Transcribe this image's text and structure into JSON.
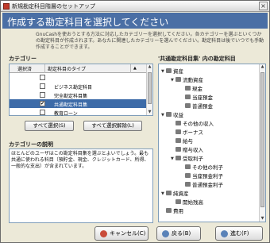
{
  "window": {
    "title": "新規勘定科目階層のセットアップ"
  },
  "banner": {
    "title": "作成する勘定科目を選択してください"
  },
  "intro": "GnuCashを使おうとする方法に対応したカテゴリーを選択してください。各カテゴリーを選ぶといくつかの勘定科目が作成されます。あなたに関連したカテゴリーを選んでください。勘定科目は後でいつでも手動作成することができます。",
  "categories": {
    "label": "カテゴリー",
    "col_selected": "選択済",
    "col_type": "勘定科目のタイプ",
    "rows": [
      {
        "checked": false,
        "name": ""
      },
      {
        "checked": false,
        "name": "ビジネス勘定科目"
      },
      {
        "checked": false,
        "name": "完全勘定科目集"
      },
      {
        "checked": true,
        "name": "共通勘定科目集",
        "selected": true
      },
      {
        "checked": false,
        "name": "教育ローン"
      }
    ],
    "select_all": "すべて選択(S)",
    "clear_all": "すべて選択解除(L)"
  },
  "description": {
    "label": "カテゴリーの説明",
    "text": "ほとんどのユーザはこの勘定科目集を選ぶとよいでしょう。最も共通に使われる科目（預貯金、現金、クレジットカード、所得、一般的な支出）が含まれています。"
  },
  "accounts_tree": {
    "label": "'共通勘定科目集' 内の勘定科目",
    "items": [
      {
        "depth": 0,
        "expanded": true,
        "name": "資産"
      },
      {
        "depth": 1,
        "expanded": true,
        "name": "流動資産"
      },
      {
        "depth": 2,
        "expanded": false,
        "name": "現金"
      },
      {
        "depth": 2,
        "expanded": false,
        "name": "当座預金"
      },
      {
        "depth": 2,
        "expanded": false,
        "name": "普通預金"
      },
      {
        "depth": 0,
        "expanded": true,
        "name": "収益"
      },
      {
        "depth": 1,
        "expanded": false,
        "name": "その他の収入"
      },
      {
        "depth": 1,
        "expanded": false,
        "name": "ボーナス"
      },
      {
        "depth": 1,
        "expanded": false,
        "name": "給与"
      },
      {
        "depth": 1,
        "expanded": false,
        "name": "贈与収入"
      },
      {
        "depth": 1,
        "expanded": true,
        "name": "受取利子"
      },
      {
        "depth": 2,
        "expanded": false,
        "name": "その他の利子"
      },
      {
        "depth": 2,
        "expanded": false,
        "name": "当座預金利子"
      },
      {
        "depth": 2,
        "expanded": false,
        "name": "普通預金利子"
      },
      {
        "depth": 0,
        "expanded": true,
        "name": "純資産"
      },
      {
        "depth": 1,
        "expanded": false,
        "name": "開始残高"
      },
      {
        "depth": 0,
        "expanded": false,
        "name": "費用"
      }
    ]
  },
  "footer": {
    "cancel": "キャンセル(C)",
    "back": "戻る(B)",
    "forward": "進む(F)"
  },
  "colors": {
    "banner": "#4a6fa5",
    "selection": "#3d6ba8"
  }
}
